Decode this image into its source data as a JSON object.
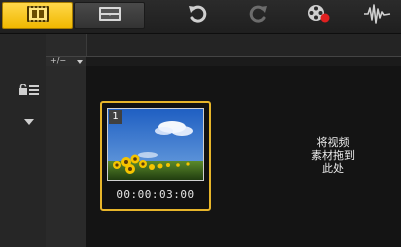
{
  "toolbar": {
    "tabs": [
      {
        "name": "storyboard-view",
        "icon": "filmstrip-icon",
        "active": true
      },
      {
        "name": "timeline-view",
        "icon": "timeline-icon",
        "active": false
      }
    ],
    "buttons": [
      {
        "name": "undo-button",
        "icon": "undo-icon"
      },
      {
        "name": "redo-button",
        "icon": "redo-icon"
      },
      {
        "name": "record-capture-button",
        "icon": "record-capture-icon"
      },
      {
        "name": "sound-mixer-button",
        "icon": "sound-mixer-icon"
      }
    ]
  },
  "track_panel": {
    "zoom_label": "+/−",
    "icons": [
      "track-manager-icon",
      "lock-tracks-icon",
      "dropdown-arrow-icon"
    ]
  },
  "storyboard": {
    "clips": [
      {
        "index": "1",
        "duration": "00:00:03:00",
        "thumbnail": "sunflower-field-image"
      }
    ],
    "drop_hint_lines": [
      "将视频",
      "素材拖到",
      "此处"
    ]
  },
  "colors": {
    "accent": "#f0b800",
    "clip_border": "#e7b52a",
    "background": "#141414",
    "record_red": "#e02020"
  }
}
